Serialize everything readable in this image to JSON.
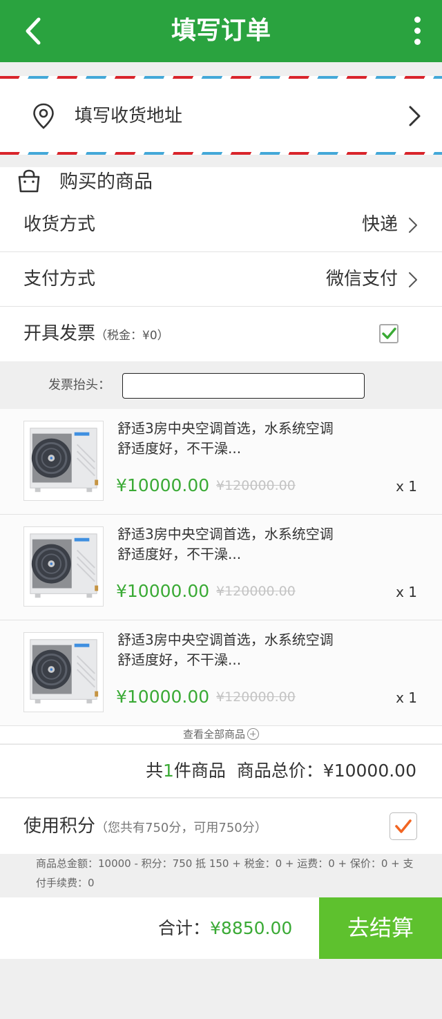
{
  "header": {
    "title": "填写订单",
    "back_icon": "chevron-left-icon",
    "menu_icon": "more-vertical-icon"
  },
  "address": {
    "label": "填写收货地址",
    "icon": "map-pin-icon"
  },
  "goods_section": {
    "title": "购买的商品",
    "icon": "shopping-bag-icon"
  },
  "delivery": {
    "label": "收货方式",
    "value": "快递"
  },
  "payment": {
    "label": "支付方式",
    "value": "微信支付"
  },
  "invoice": {
    "label": "开具发票",
    "tax_note": "（税金：¥0）",
    "checked": true,
    "title_label": "发票抬头：",
    "title_value": ""
  },
  "products": [
    {
      "name": "舒适3房中央空调首选，水系统空调舒适度好，不干澡...",
      "price": "¥10000.00",
      "original_price": "¥120000.00",
      "qty": "x 1"
    },
    {
      "name": "舒适3房中央空调首选，水系统空调舒适度好，不干澡...",
      "price": "¥10000.00",
      "original_price": "¥120000.00",
      "qty": "x 1"
    },
    {
      "name": "舒适3房中央空调首选，水系统空调舒适度好，不干澡...",
      "price": "¥10000.00",
      "original_price": "¥120000.00",
      "qty": "x 1"
    }
  ],
  "view_all": "查看全部商品",
  "summary": {
    "count_prefix": "共",
    "count": "1",
    "count_suffix": "件商品",
    "total_label": "商品总价：",
    "total_value": "¥10000.00"
  },
  "points": {
    "label": "使用积分",
    "note": "（您共有750分，可用750分）",
    "checked": true
  },
  "formula": "商品总金额：10000 - 积分：750 抵 150 + 税金：0 + 运费：0 + 保价：0 + 支付手续费：0",
  "footer": {
    "sum_label": "合计：",
    "sum_value": "¥8850.00",
    "checkout_label": "去结算"
  },
  "colors": {
    "header": "#2aa33f",
    "price": "#3aaa35",
    "checkout": "#5ec12e",
    "points_check": "#f26522"
  }
}
